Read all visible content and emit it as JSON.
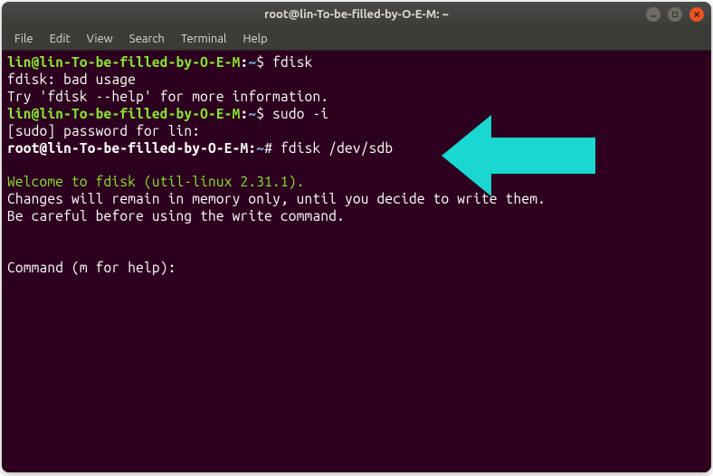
{
  "window": {
    "title": "root@lin-To-be-filled-by-O-E-M: ~"
  },
  "menubar": {
    "file": "File",
    "edit": "Edit",
    "view": "View",
    "search": "Search",
    "terminal": "Terminal",
    "help": "Help"
  },
  "term": {
    "user_prompt": "lin@lin-To-be-filled-by-O-E-M",
    "sep": ":",
    "user_path": "~",
    "user_sym": "$ ",
    "cmd1": "fdisk",
    "out1": "fdisk: bad usage",
    "out2": "Try 'fdisk --help' for more information.",
    "cmd2": "sudo -i",
    "out3": "[sudo] password for lin:",
    "root_prompt": "root@lin-To-be-filled-by-O-E-M",
    "root_path": "~",
    "root_sym": "# ",
    "cmd3": "fdisk /dev/sdb",
    "blank": " ",
    "welcome": "Welcome to fdisk (util-linux 2.31.1).",
    "out4": "Changes will remain in memory only, until you decide to write them.",
    "out5": "Be careful before using the write command.",
    "prompt_line": "Command (m for help):"
  },
  "colors": {
    "arrow": "#1ad7d1"
  }
}
